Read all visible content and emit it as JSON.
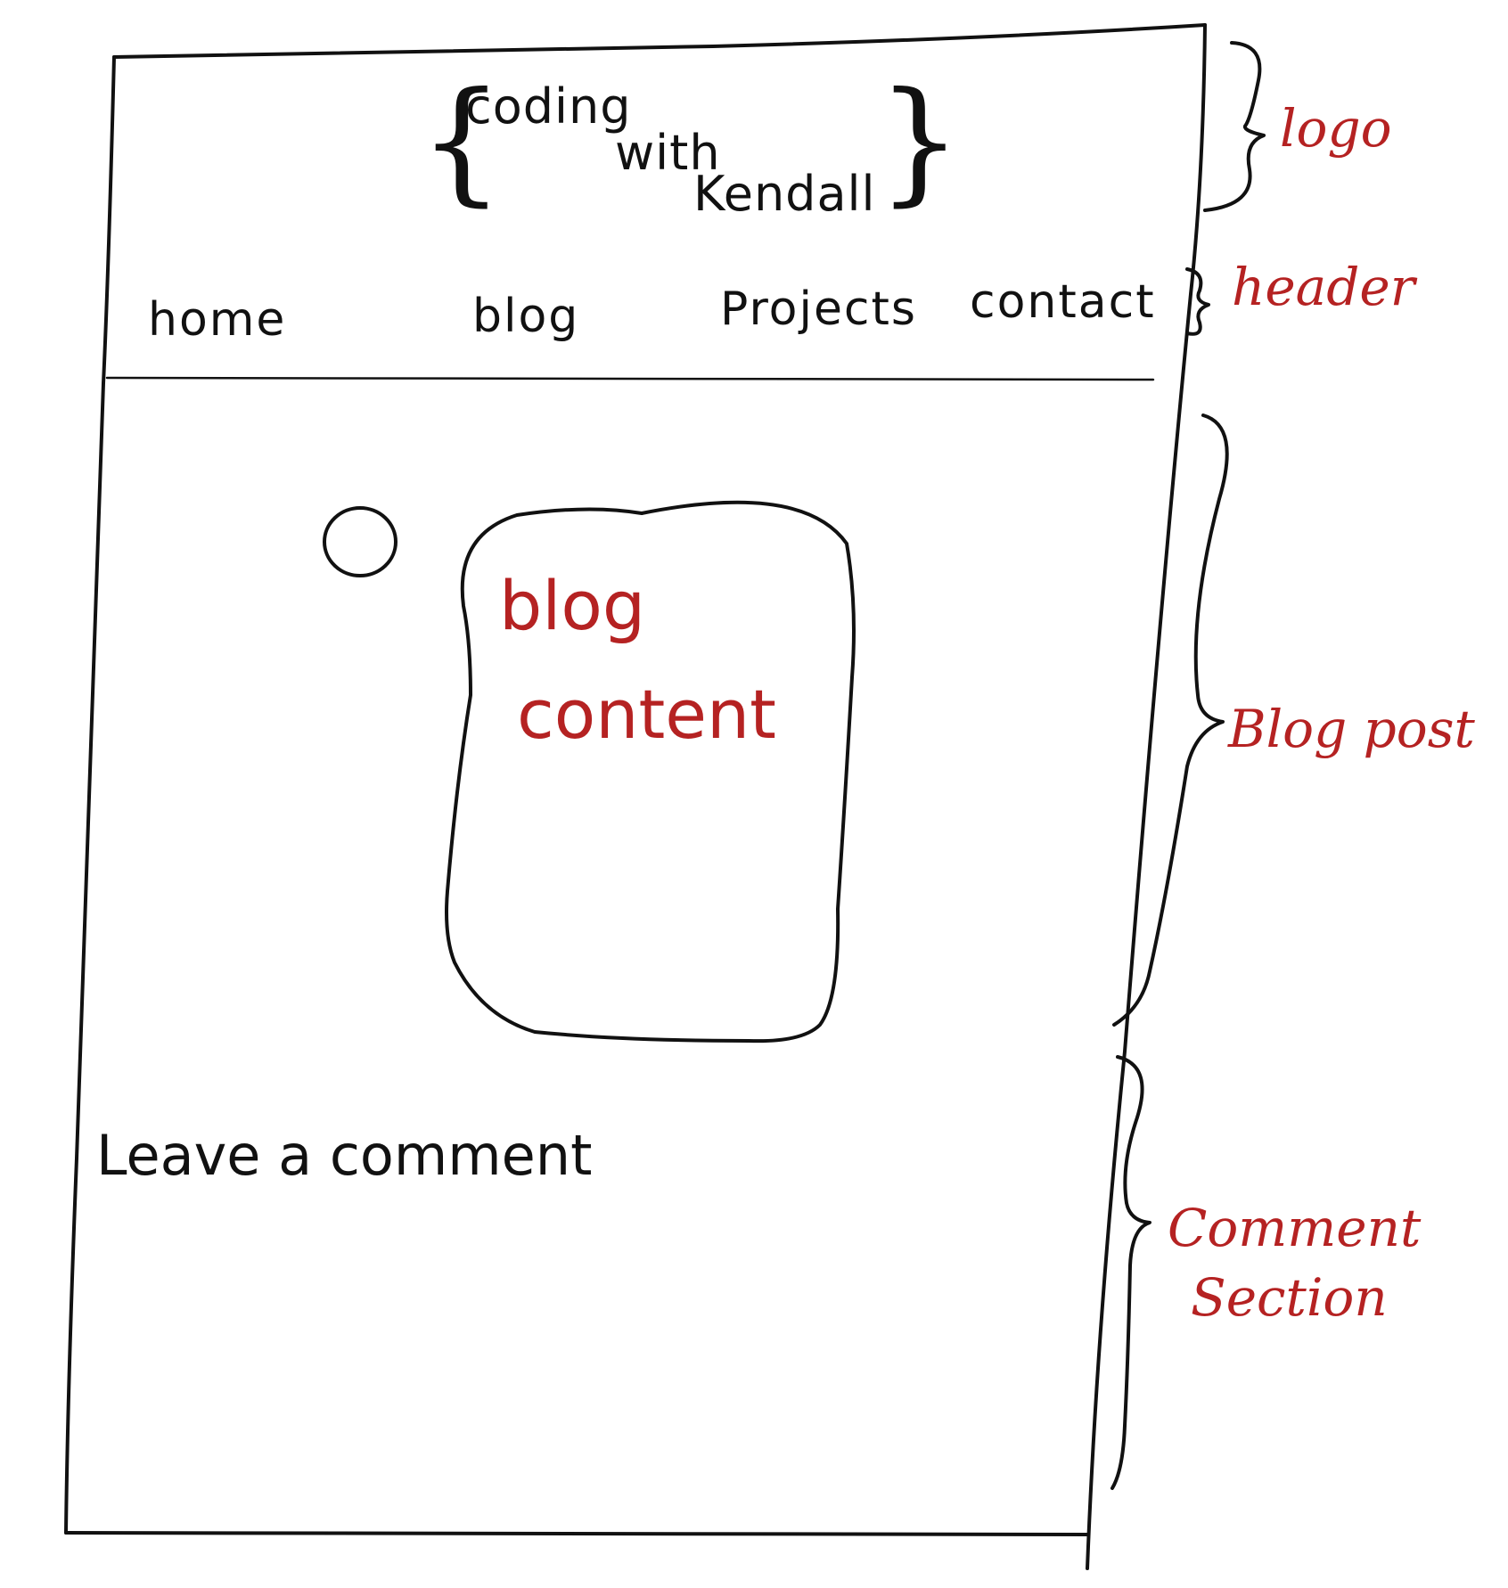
{
  "logo": {
    "line1": "coding",
    "line2": "with",
    "line3": "Kendall",
    "brace_left": "{",
    "brace_right": "}"
  },
  "nav": {
    "items": [
      "home",
      "blog",
      "Projects",
      "contact"
    ]
  },
  "blog_post": {
    "content_line1": "blog",
    "content_line2": "content"
  },
  "comment": {
    "heading": "Leave a comment"
  },
  "annotations": {
    "logo": "logo",
    "header": "header",
    "blog_post": "Blog post",
    "comment_line1": "Comment",
    "comment_line2": "Section"
  },
  "colors": {
    "ink": "#111111",
    "annotation": "#b52222"
  }
}
